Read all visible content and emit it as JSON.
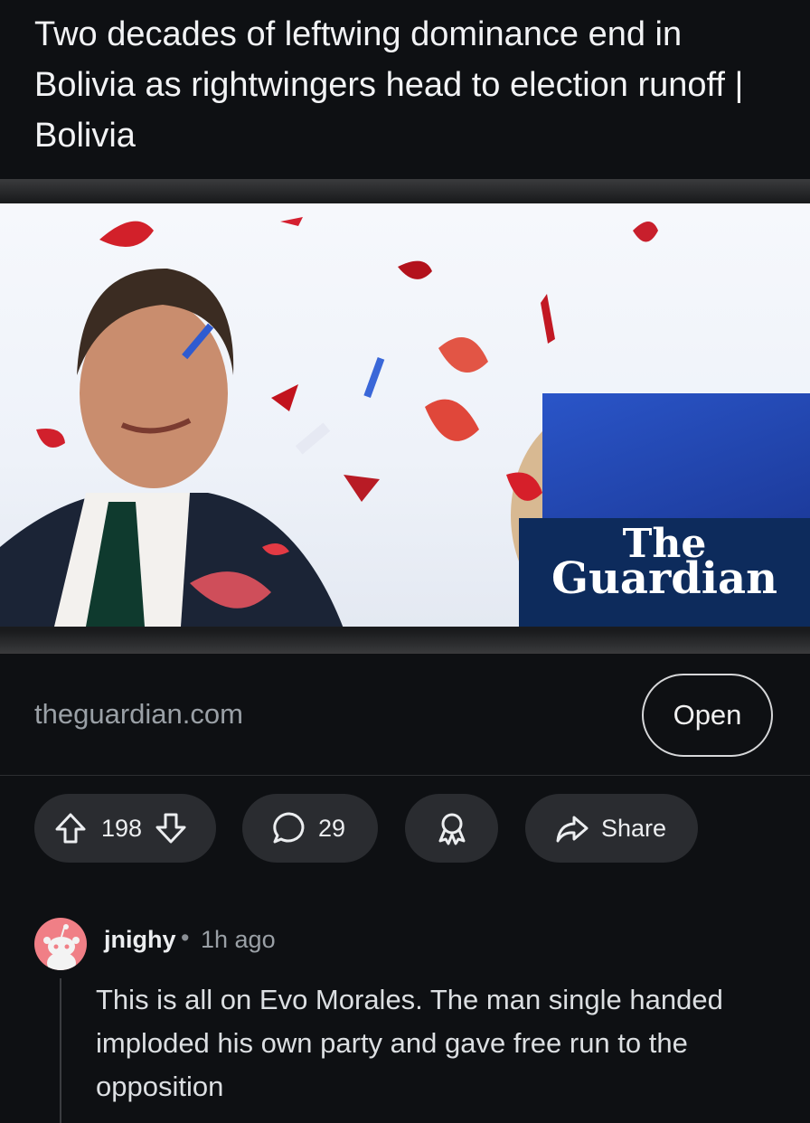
{
  "post": {
    "title": "Two decades of leftwing dominance end in Bolivia as rightwingers head to election runoff | Bolivia"
  },
  "link": {
    "logo_the": "The",
    "logo_guardian": "Guardian",
    "domain": "theguardian.com",
    "open_label": "Open"
  },
  "actions": {
    "votes": "198",
    "comments": "29",
    "share_label": "Share"
  },
  "comment": {
    "username": "jnighy",
    "separator": "•",
    "time": "1h ago",
    "text": "This is all on Evo Morales. The man single handed imploded his own party and gave free run to the opposition"
  },
  "colors": {
    "background": "#0e1013",
    "pill": "#2a2c30",
    "guardian_navy": "#0d2b5c",
    "avatar": "#f07f86"
  }
}
